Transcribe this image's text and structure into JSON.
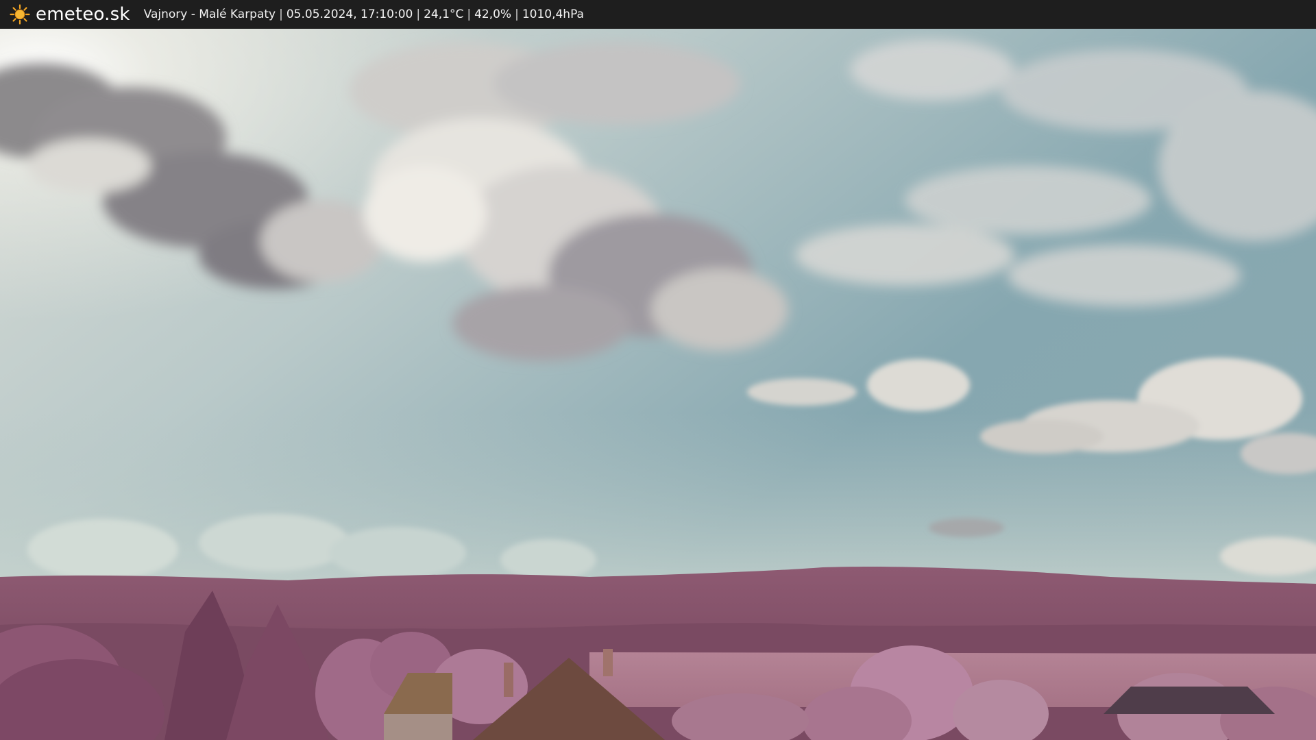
{
  "brand": {
    "name": "emeteo.sk",
    "icon": "sun-icon",
    "icon_color": "#f5a623"
  },
  "caption": {
    "location": "Vajnory - Malé Karpaty",
    "datetime": "05.05.2024, 17:10:00",
    "temperature": "24,1°C",
    "humidity": "42,0%",
    "pressure": "1010,4hPa",
    "separator": "|"
  },
  "webcam": {
    "content": "webcam-image",
    "sky_color": "#7fa3ad",
    "vegetation_color": "#a0607e"
  }
}
